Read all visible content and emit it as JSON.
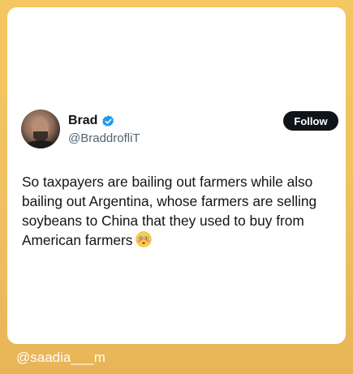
{
  "post": {
    "author": {
      "name": "Brad",
      "handle": "@BraddrofliT",
      "verified": true
    },
    "follow_label": "Follow",
    "text_lines": [
      "So taxpayers are bailing out farmers while also",
      "bailing out Argentina, whose farmers are selling",
      "soybeans to China that they used to buy from",
      "American farmers"
    ],
    "emoji": "flushed-face"
  },
  "watermark": "@saadia___m",
  "colors": {
    "background": "#f4c763",
    "card": "#ffffff",
    "verified_badge": "#1d9bf0",
    "follow_button": "#0f1419",
    "handle_text": "#536471"
  }
}
